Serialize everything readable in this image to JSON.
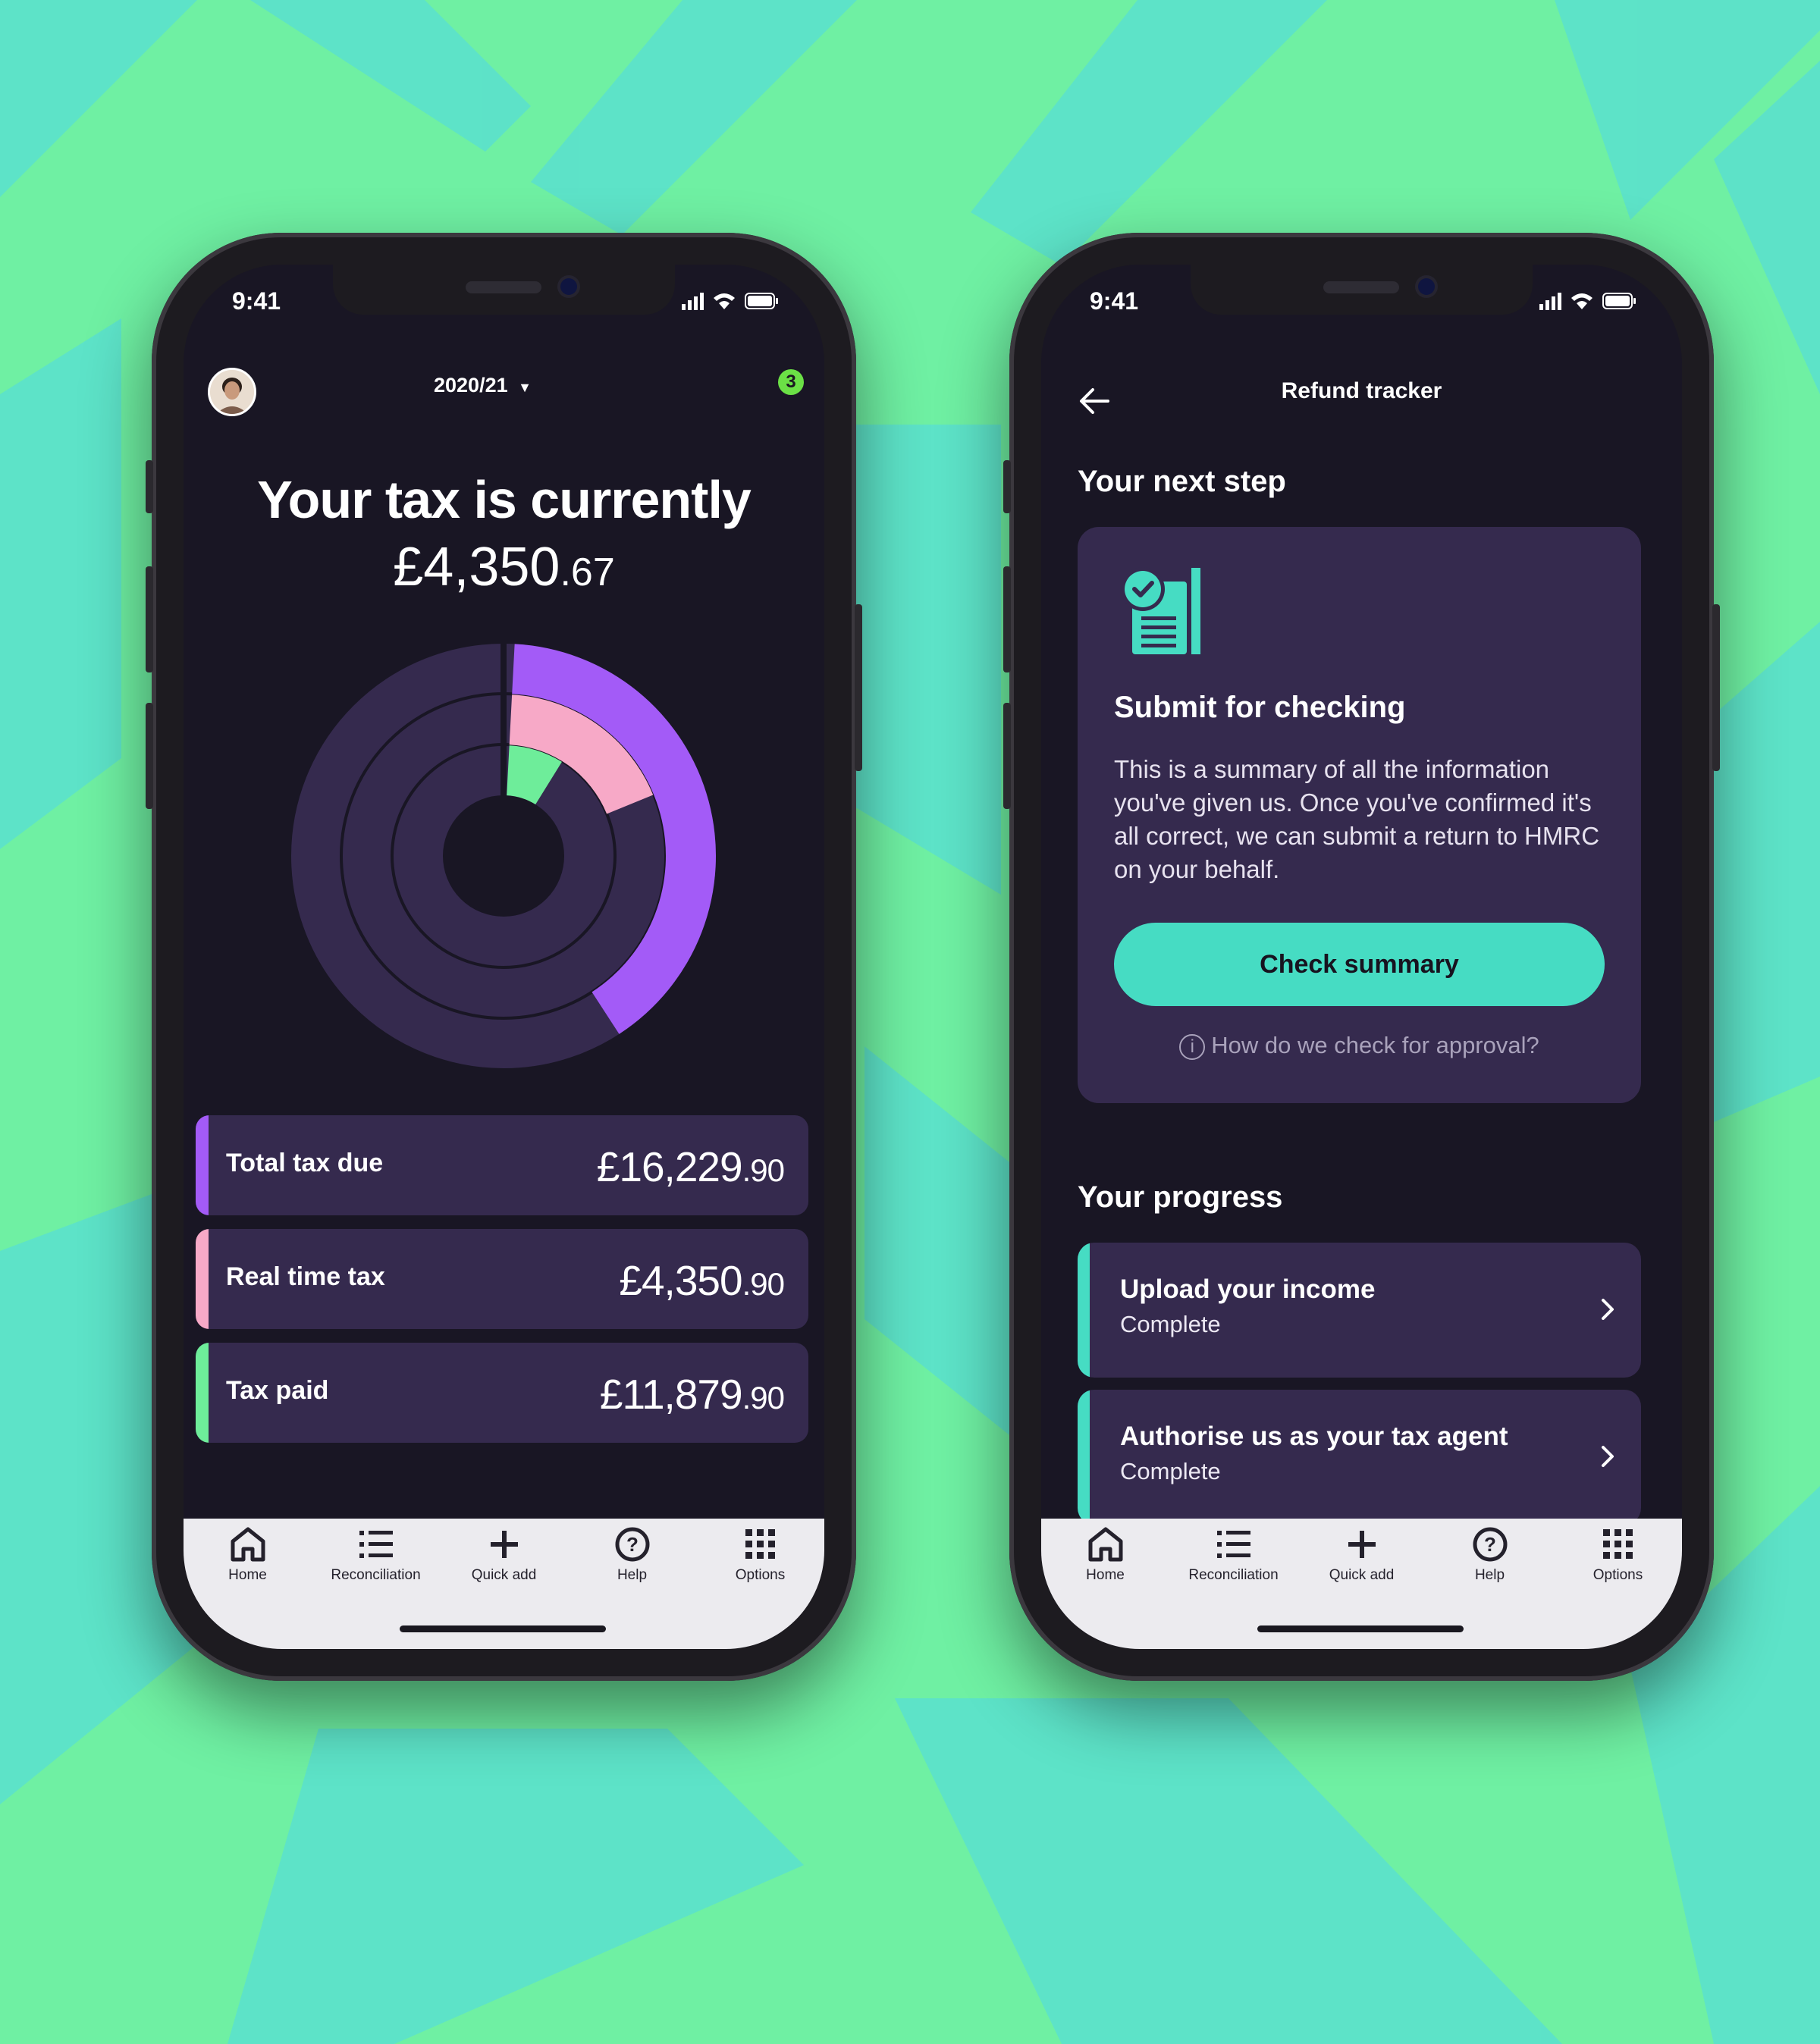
{
  "colors": {
    "background": "#6ff0a3",
    "screen": "#191624",
    "card": "#352a4e",
    "purple": "#a35bf7",
    "pink": "#f7a9c7",
    "green": "#6eed9a",
    "teal": "#46dcc3"
  },
  "left_phone": {
    "status": {
      "time": "9:41"
    },
    "header": {
      "tax_year": "2020/21",
      "notification_count": "3"
    },
    "summary": {
      "title": "Your tax is currently",
      "amount_main": "£4,350",
      "amount_pence": ".67"
    },
    "chart_data": {
      "type": "radial-bar",
      "series": [
        {
          "name": "Total tax due",
          "value": 16229.9,
          "color": "#a35bf7"
        },
        {
          "name": "Real time tax",
          "value": 4350.9,
          "color": "#f7a9c7"
        },
        {
          "name": "Tax paid",
          "value": 11879.9,
          "color": "#6eed9a"
        }
      ],
      "ring_fill_fraction": [
        0.4,
        0.18,
        0.08
      ]
    },
    "cards": [
      {
        "label": "Total tax due",
        "amount": "£16,229",
        "pence": ".90",
        "color": "#a35bf7"
      },
      {
        "label": "Real time tax",
        "amount": "£4,350",
        "pence": ".90",
        "color": "#f7a9c7"
      },
      {
        "label": "Tax paid",
        "amount": "£11,879",
        "pence": ".90",
        "color": "#6eed9a"
      }
    ]
  },
  "right_phone": {
    "status": {
      "time": "9:41"
    },
    "header": {
      "title": "Refund tracker"
    },
    "next_step": {
      "section_title": "Your next step",
      "heading": "Submit for checking",
      "body": "This is a summary of all the information you've given us. Once you've confirmed it's all correct, we can submit a return to HMRC on your behalf.",
      "button": "Check summary",
      "help_link": "How do we check for approval?"
    },
    "progress": {
      "section_title": "Your progress",
      "items": [
        {
          "title": "Upload your income",
          "status": "Complete"
        },
        {
          "title": "Authorise us as your tax agent",
          "status": "Complete"
        }
      ]
    }
  },
  "tabbar": {
    "items": [
      {
        "label": "Home",
        "icon": "home-icon"
      },
      {
        "label": "Reconciliation",
        "icon": "list-icon"
      },
      {
        "label": "Quick add",
        "icon": "plus-icon"
      },
      {
        "label": "Help",
        "icon": "help-icon"
      },
      {
        "label": "Options",
        "icon": "grid-icon"
      }
    ]
  }
}
